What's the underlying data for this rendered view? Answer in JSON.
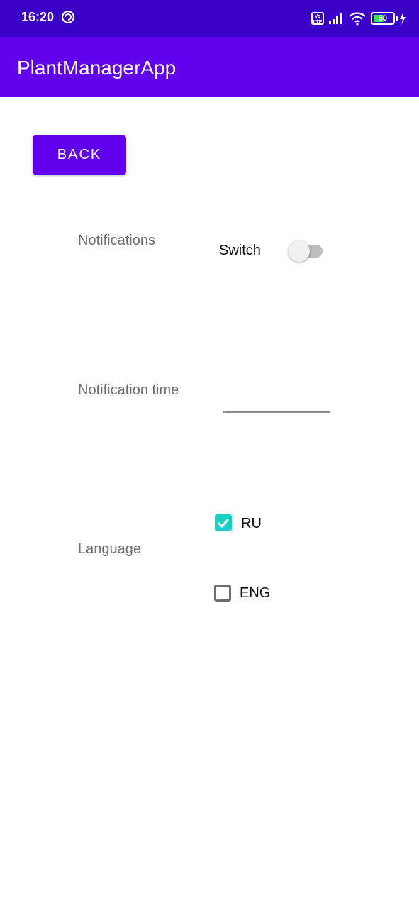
{
  "status_bar": {
    "time": "16:20",
    "volte": "Vo LTE",
    "battery": "50",
    "icons": [
      "sync-icon",
      "volte-icon",
      "signal-icon",
      "wifi-icon",
      "battery-icon",
      "charging-icon"
    ]
  },
  "app_bar": {
    "title": "PlantManagerApp"
  },
  "back_button": {
    "label": "BACK"
  },
  "notifications": {
    "label": "Notifications",
    "switch_text": "Switch",
    "switch_on": false
  },
  "notification_time": {
    "label": "Notification time",
    "value": ""
  },
  "language": {
    "label": "Language",
    "options": [
      {
        "label": "RU",
        "checked": true
      },
      {
        "label": "ENG",
        "checked": false
      }
    ]
  },
  "colors": {
    "status_bar": "#3a00c8",
    "app_bar": "#6200ee",
    "checkbox_checked": "#1ccfc3"
  }
}
